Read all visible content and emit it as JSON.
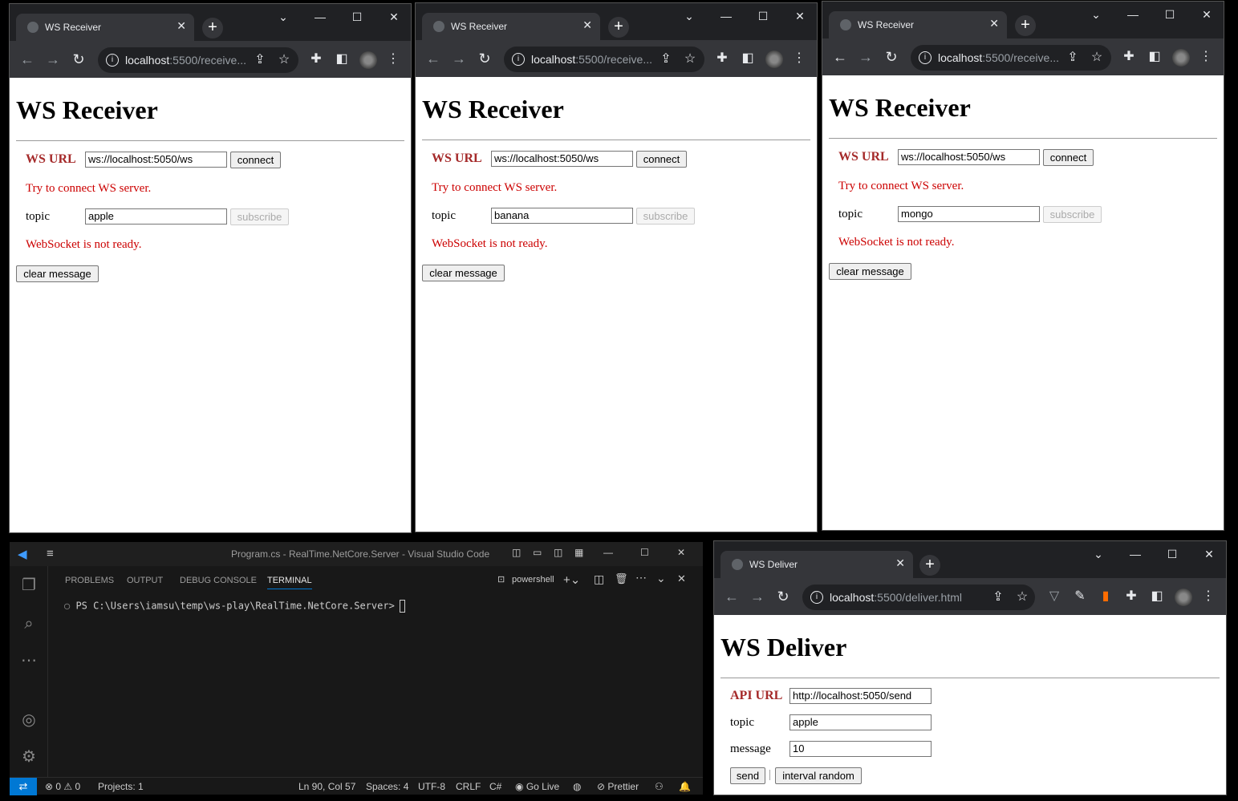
{
  "receivers": [
    {
      "tab_title": "WS Receiver",
      "url_host": "localhost",
      "url_path": ":5500/receive...",
      "heading": "WS Receiver",
      "ws_url_label": "WS URL",
      "ws_url_value": "ws://localhost:5050/ws",
      "connect_label": "connect",
      "status_msg": "Try to connect WS server.",
      "topic_label": "topic",
      "topic_value": "apple",
      "subscribe_label": "subscribe",
      "ready_msg": "WebSocket is not ready.",
      "clear_label": "clear message"
    },
    {
      "tab_title": "WS Receiver",
      "url_host": "localhost",
      "url_path": ":5500/receive...",
      "heading": "WS Receiver",
      "ws_url_label": "WS URL",
      "ws_url_value": "ws://localhost:5050/ws",
      "connect_label": "connect",
      "status_msg": "Try to connect WS server.",
      "topic_label": "topic",
      "topic_value": "banana",
      "subscribe_label": "subscribe",
      "ready_msg": "WebSocket is not ready.",
      "clear_label": "clear message"
    },
    {
      "tab_title": "WS Receiver",
      "url_host": "localhost",
      "url_path": ":5500/receive...",
      "heading": "WS Receiver",
      "ws_url_label": "WS URL",
      "ws_url_value": "ws://localhost:5050/ws",
      "connect_label": "connect",
      "status_msg": "Try to connect WS server.",
      "topic_label": "topic",
      "topic_value": "mongo",
      "subscribe_label": "subscribe",
      "ready_msg": "WebSocket is not ready.",
      "clear_label": "clear message"
    }
  ],
  "deliver": {
    "tab_title": "WS Deliver",
    "url_host": "localhost",
    "url_path": ":5500/deliver.html",
    "heading": "WS Deliver",
    "api_url_label": "API URL",
    "api_url_value": "http://localhost:5050/send",
    "topic_label": "topic",
    "topic_value": "apple",
    "message_label": "message",
    "message_value": "10",
    "send_label": "send",
    "separator": "|",
    "interval_label": "interval random"
  },
  "vscode": {
    "title": "Program.cs - RealTime.NetCore.Server - Visual Studio Code",
    "panel_tabs": [
      "PROBLEMS",
      "OUTPUT",
      "DEBUG CONSOLE",
      "TERMINAL"
    ],
    "shell": "powershell",
    "prompt": "PS C:\\Users\\iamsu\\temp\\ws-play\\RealTime.NetCore.Server>",
    "status": {
      "errors": "0",
      "warnings": "0",
      "projects": "Projects: 1",
      "position": "Ln 90, Col 57",
      "spaces": "Spaces: 4",
      "encoding": "UTF-8",
      "eol": "CRLF",
      "language": "C#",
      "golive": "Go Live",
      "prettier": "Prettier"
    }
  }
}
